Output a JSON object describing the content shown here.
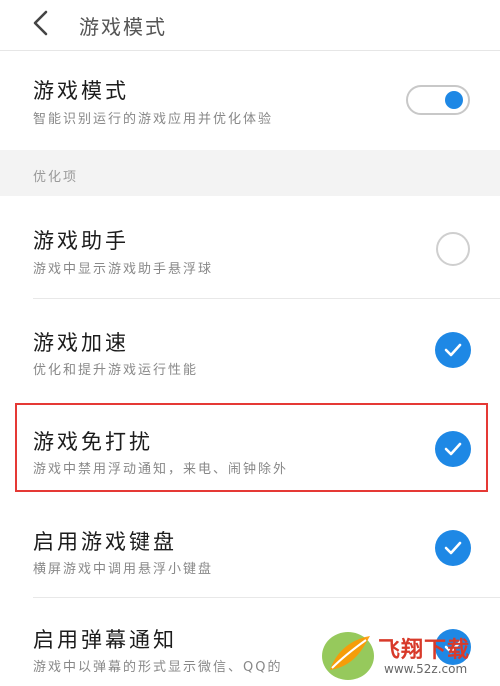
{
  "header": {
    "title": "游戏模式",
    "back_icon": "chevron-left-icon"
  },
  "game_mode": {
    "title": "游戏模式",
    "desc": "智能识别运行的游戏应用并优化体验",
    "enabled": true
  },
  "section": {
    "label": "优化项"
  },
  "items": [
    {
      "title": "游戏助手",
      "desc": "游戏中显示游戏助手悬浮球",
      "checked": false
    },
    {
      "title": "游戏加速",
      "desc": "优化和提升游戏运行性能",
      "checked": true
    },
    {
      "title": "游戏免打扰",
      "desc": "游戏中禁用浮动通知，来电、闹钟除外",
      "checked": true
    },
    {
      "title": "启用游戏键盘",
      "desc": "横屏游戏中调用悬浮小键盘",
      "checked": true
    },
    {
      "title": "启用弹幕通知",
      "desc": "游戏中以弹幕的形式显示微信、QQ的",
      "checked": true
    }
  ],
  "watermark": {
    "name": "飞翔下载",
    "url": "www.52z.com"
  },
  "colors": {
    "accent": "#1e88e5",
    "highlight": "#e53935"
  }
}
